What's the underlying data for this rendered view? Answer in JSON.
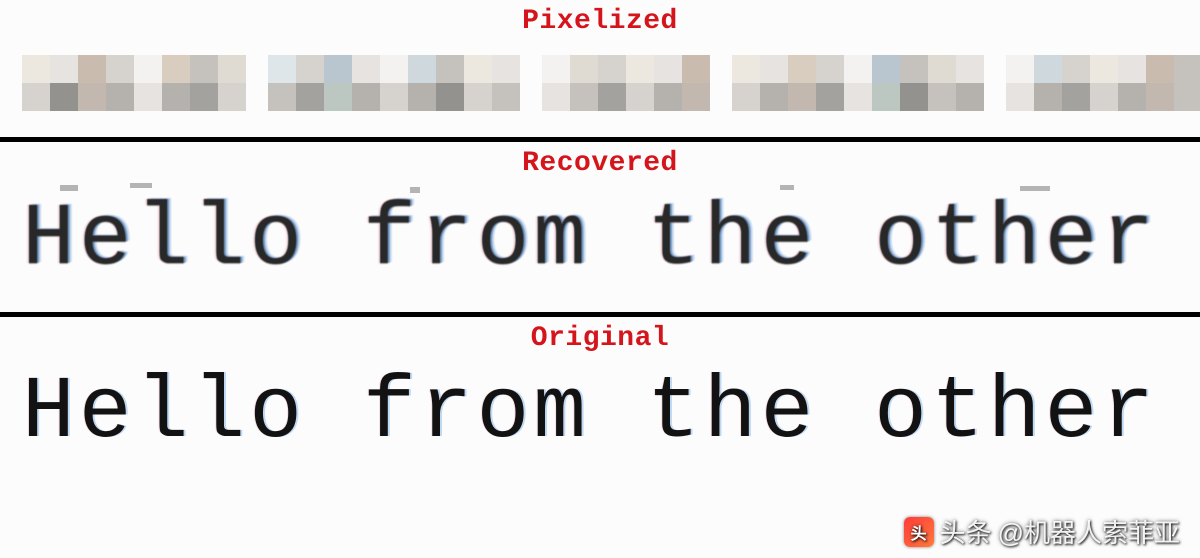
{
  "sections": {
    "pixelized": {
      "label": "Pixelized"
    },
    "recovered": {
      "label": "Recovered",
      "text": "Hello from the other side"
    },
    "original": {
      "label": "Original",
      "text": "Hello from the other side"
    }
  },
  "watermark": {
    "prefix": "头条",
    "handle": "@机器人索菲亚"
  },
  "colors": {
    "label": "#d4151b",
    "divider": "#000000",
    "background": "#fdfcfc"
  },
  "pixel_palette": {
    "a": "#f4f2f0",
    "b": "#e6e3e0",
    "c": "#d6d3cf",
    "d": "#c5c2be",
    "e": "#b5b2ae",
    "f": "#a4a29e",
    "g": "#94928e",
    "h": "#c9bcae",
    "i": "#b9c6cf",
    "j": "#d9cdc0",
    "k": "#cfd8dd",
    "l": "#ece7df",
    "m": "#dfe6ea",
    "n": "#bcc7c2",
    "o": "#c2b8b0",
    "p": "#e0dbd2"
  },
  "pixel_words": [
    [
      [
        "l",
        "b",
        "h",
        "c",
        "a",
        "j",
        "d",
        "p"
      ],
      [
        "c",
        "g",
        "o",
        "e",
        "b",
        "e",
        "f",
        "c"
      ]
    ],
    [
      [
        "m",
        "c",
        "i",
        "b",
        "a",
        "k",
        "d",
        "l",
        "b"
      ],
      [
        "d",
        "f",
        "n",
        "e",
        "c",
        "e",
        "g",
        "c",
        "d"
      ]
    ],
    [
      [
        "a",
        "p",
        "c",
        "l",
        "b",
        "h"
      ],
      [
        "b",
        "d",
        "f",
        "c",
        "e",
        "o"
      ]
    ],
    [
      [
        "l",
        "b",
        "j",
        "c",
        "a",
        "i",
        "d",
        "p",
        "b"
      ],
      [
        "c",
        "e",
        "o",
        "f",
        "b",
        "n",
        "g",
        "d",
        "e"
      ]
    ],
    [
      [
        "a",
        "k",
        "c",
        "l",
        "b",
        "h",
        "d"
      ],
      [
        "b",
        "e",
        "f",
        "c",
        "e",
        "o",
        "d"
      ]
    ]
  ]
}
